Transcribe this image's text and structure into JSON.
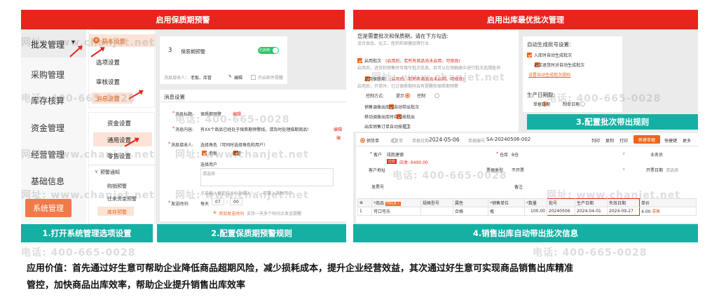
{
  "headers": {
    "left": "启用保质期预警",
    "right": "启用出库最优批次管理"
  },
  "captions": {
    "step1": "1.打开系统管理选项设置",
    "step2": "2.配置保质期预警规则",
    "step3": "3.配置批次带出规则",
    "step4": "4.销售出库自动带出批次信息"
  },
  "watermarks": {
    "url_prefix": "网址:",
    "url": "www.chanjet.net",
    "tel_prefix": "电话:",
    "tel": "400-665-0028"
  },
  "sidebar": {
    "items": [
      "批发管理",
      "采购管理",
      "库存核算",
      "资金管理",
      "经营管理",
      "基础信息"
    ],
    "system_btn": "系统管理"
  },
  "submenu1": {
    "header": "基本设置",
    "items": [
      "选项设置",
      "审核设置",
      "消息设置"
    ]
  },
  "submenu2": {
    "items": [
      "资金设置",
      "通用设置",
      "零售设置"
    ],
    "group": "预警通知",
    "sub_items": [
      "购销预警",
      "往来资金预警",
      "库存预警"
    ]
  },
  "alert_config": {
    "row_num": "3",
    "row_name": "保质期预警",
    "toggle": "已启用",
    "recv_label": "消息接收人：",
    "recv_value": "老板、库管",
    "edit": "编辑",
    "remind": "开启邮件提醒",
    "section": "消息设置",
    "title_label": "消息标题:",
    "title_value": "保质期预警",
    "content_label": "消息内容:",
    "content_value": "有XX个商品已经处于保质期预警线，请及时处理临期商品！",
    "receiver_label": "消息接收人:",
    "receiver_hint": "选择角色（可同时选择角色和用户）",
    "role1": "老板",
    "role2": "库管",
    "select_user": "选择用户",
    "select_placeholder": "请选择",
    "user_hint": "点击输入框定位光标处输入\"...\"，可输入其他用户",
    "time_label": "发送时间:",
    "time_every": "每天",
    "time_h": "07",
    "time_m": "00",
    "add_time": "添加发送时间",
    "add_time_hint": "支持一天多个时间点发送提醒",
    "edit_link": "编辑",
    "edit_short": "编"
  },
  "batch_config": {
    "question": "您是需要批次和保质期，请在下方勾选:",
    "examples": "适合食品、化工、医药和保健品等行业",
    "opt1": "启用批次",
    "opt1_note": "(启用后，若所有商品尚未启用，可修改)",
    "opt1_desc": "启用后，进货和销售时可填写批次信息，且可以在明细表中进行批次追溯查询",
    "opt2": "启用保质期",
    "opt2_note": "(启用后，若所有商品尚未启用，可修改)",
    "opt2_desc": "启用后，开单时，已过保质期时会有提醒和保质期预警",
    "control_label": "控制方式:",
    "control_opt1": "提示",
    "control_opt2": "控制",
    "c1": "销售调拨出库时自动带出批次",
    "c2": "移动调拨出库时自动按批出",
    "c3": "出库销售订单自动按批次",
    "gen_title": "自动生成批号设置:",
    "gen1": "入库时自动生成批次",
    "gen2": "出库退货时对自动生成批次",
    "gen_link": "设置自动生成批次规则",
    "date_title": "生产日期取:",
    "date1": "单据日期",
    "date2": "制单日期"
  },
  "sales_form": {
    "tab1": "销货单",
    "tab2": "退货单",
    "date_label": "单据日期",
    "date": "2024-05-06",
    "no_label": "单据编号",
    "no": "SA-20240506-002",
    "actions": [
      "列印",
      "复制",
      "打印"
    ],
    "action_orange": "新建单据",
    "quick": "快捷键",
    "more": "更多",
    "customer_label": "客户",
    "customer": "段胜建德",
    "badge": "应收",
    "arrears": "应收: 6490.00",
    "warehouse_label": "仓库",
    "warehouse": "B仓",
    "salesman_label": "业务员",
    "address_label": "客户地址",
    "invoice_label": "票据类型",
    "invoice": "不开票",
    "maker_label": "开票日期",
    "maker_placeholder": "请选择",
    "shipper_label": "发票号",
    "note_label": "备注",
    "cols": [
      "商品",
      "规格型号",
      "属性",
      "销售单位",
      "数量",
      "批号",
      "生产日期",
      "失效日期",
      "单价"
    ],
    "search_badge": "扫码录入",
    "row": {
      "no": "1",
      "product": "可口可乐",
      "spec": "",
      "attr": "合格",
      "unit": "瓶",
      "qty": "100.00",
      "batch": "20240506",
      "mfg": "2024-04-01",
      "exp": "2024-09-27",
      "price": "4.00",
      "extra": "零售"
    }
  },
  "value_statement": {
    "line1": "应用价值：首先通过好生意可帮助企业降低商品超期风险，减少损耗成本，提升企业经营效益，其次通过好生意可实现商品销售出库精准",
    "line2": "管控，加快商品出库效率，帮助企业提升销售出库效率"
  }
}
